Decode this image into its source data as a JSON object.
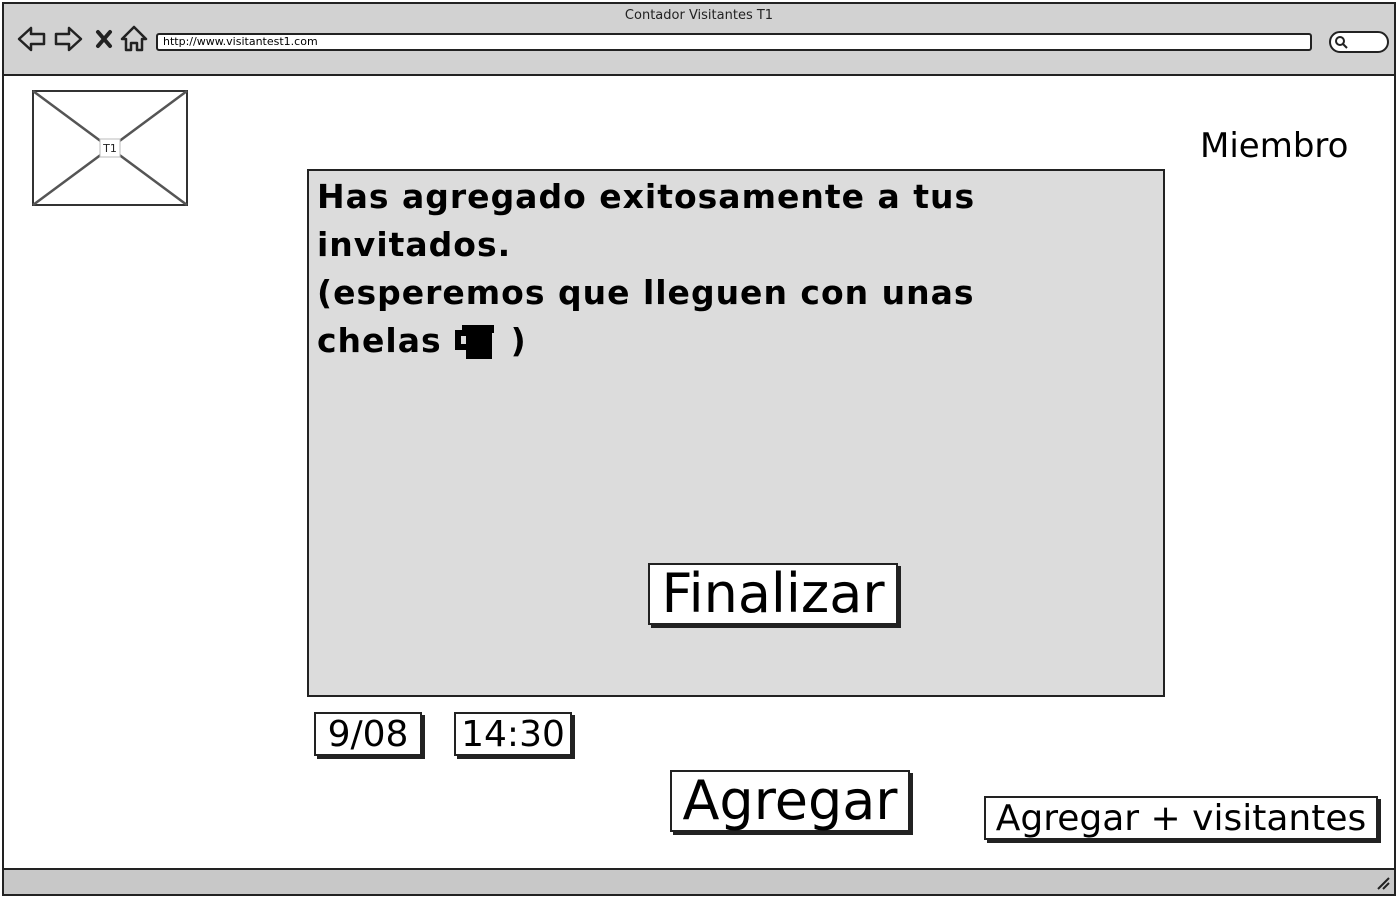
{
  "browser": {
    "title": "Contador Visitantes T1",
    "url": "http://www.visitantest1.com"
  },
  "logo": {
    "label": "T1"
  },
  "header": {
    "member_label": "Miembro"
  },
  "dialog": {
    "line1": "Has agregado exitosamente a tus invitados.",
    "line2": "(esperemos que lleguen con unas",
    "line3a": "chelas",
    "line3b": ")",
    "finish_label": "Finalizar"
  },
  "form": {
    "date_value": "9/08",
    "time_value": "14:30",
    "add_label": "Agregar",
    "add_more_label": "Agregar + visitantes"
  },
  "colors": {
    "chrome": "#d2d2d2",
    "dialog_bg": "#dcdcdc",
    "ink": "#222222"
  }
}
